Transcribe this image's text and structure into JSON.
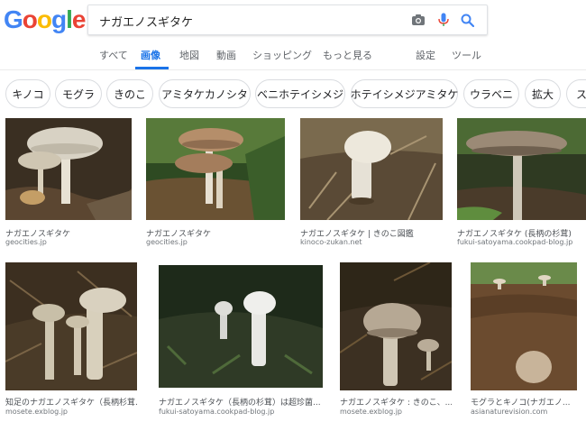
{
  "logo": {
    "letters": [
      "G",
      "o",
      "o",
      "g",
      "l",
      "e"
    ],
    "colors": [
      "#4285F4",
      "#EA4335",
      "#FBBC05",
      "#4285F4",
      "#34A853",
      "#EA4335"
    ]
  },
  "search": {
    "query": "ナガエノスギタケ"
  },
  "tabs": [
    {
      "label": "すべて"
    },
    {
      "label": "画像"
    },
    {
      "label": "地図"
    },
    {
      "label": "動画"
    },
    {
      "label": "ショッピング"
    },
    {
      "label": "もっと見る"
    },
    {
      "label": "設定"
    },
    {
      "label": "ツール"
    }
  ],
  "chips": [
    "キノコ",
    "モグラ",
    "きのこ",
    "アミタケカノシタ",
    "ベニホテイシメジ",
    "ホテイシメジアミタケ",
    "ウラベニ",
    "拡大",
    "ス"
  ],
  "results": [
    {
      "caption": "ナガエノスギタケ",
      "source": "geocities.jp"
    },
    {
      "caption": "ナガエノスギタケ",
      "source": "geocities.jp"
    },
    {
      "caption": "ナガエノスギタケ | きのこ図鑑",
      "source": "kinoco-zukan.net"
    },
    {
      "caption": "ナガエノスギタケ (長柄の杉茸)",
      "source": "fukui-satoyama.cookpad-blog.jp"
    },
    {
      "caption": "知足のナガエノスギタケ（長柄杉茸...",
      "source": "mosete.exblog.jp"
    },
    {
      "caption": "ナガエノスギタケ（長柄の杉茸）は超珍菌...",
      "source": "fukui-satoyama.cookpad-blog.jp"
    },
    {
      "caption": "ナガエノスギタケ : きのこ、...",
      "source": "mosete.exblog.jp"
    },
    {
      "caption": "モグラとキノコ(ナガエノ...",
      "source": "asianaturevision.com"
    }
  ],
  "colors": {
    "accent": "#1a73e8",
    "mic_blue": "#4285F4",
    "mic_red": "#EA4335"
  }
}
